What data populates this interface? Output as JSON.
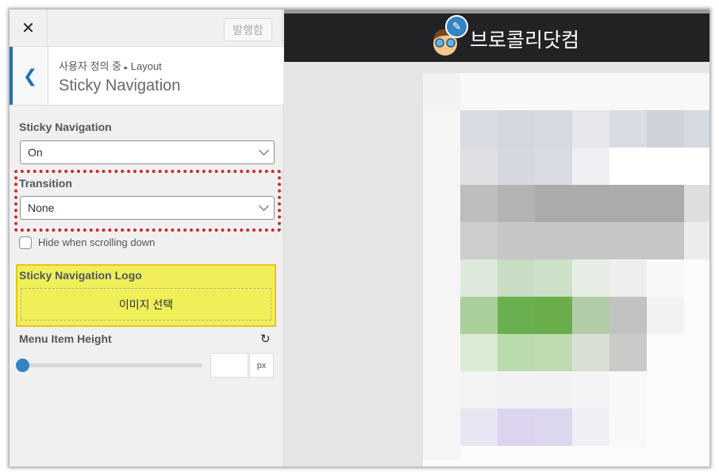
{
  "topbar": {
    "close_icon": "close-icon",
    "publish_label": "발행함"
  },
  "header": {
    "breadcrumb_parent": "사용자 정의 중",
    "breadcrumb_sep": "▸",
    "breadcrumb_current": "Layout",
    "title": "Sticky Navigation"
  },
  "controls": {
    "sticky_nav": {
      "label": "Sticky Navigation",
      "value": "On"
    },
    "transition": {
      "label": "Transition",
      "value": "None"
    },
    "hide_scroll": {
      "label": "Hide when scrolling down",
      "checked": false
    },
    "logo": {
      "label": "Sticky Navigation Logo",
      "button": "이미지 선택"
    },
    "menu_height": {
      "label": "Menu Item Height",
      "value": "",
      "unit": "px",
      "slider_percent": 0
    }
  },
  "preview": {
    "site_title": "브로콜리닷컴"
  },
  "colors": {
    "accent": "#2271b1",
    "highlight_red": "#cc2a2a",
    "highlight_yellow": "#f0ef5a"
  }
}
